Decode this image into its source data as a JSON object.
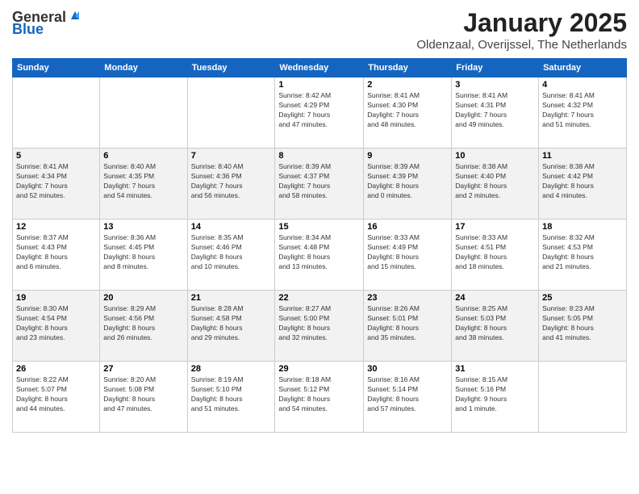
{
  "logo": {
    "general": "General",
    "blue": "Blue"
  },
  "header": {
    "title": "January 2025",
    "location": "Oldenzaal, Overijssel, The Netherlands"
  },
  "weekdays": [
    "Sunday",
    "Monday",
    "Tuesday",
    "Wednesday",
    "Thursday",
    "Friday",
    "Saturday"
  ],
  "weeks": [
    [
      {
        "day": "",
        "info": ""
      },
      {
        "day": "",
        "info": ""
      },
      {
        "day": "",
        "info": ""
      },
      {
        "day": "1",
        "info": "Sunrise: 8:42 AM\nSunset: 4:29 PM\nDaylight: 7 hours and 47 minutes."
      },
      {
        "day": "2",
        "info": "Sunrise: 8:41 AM\nSunset: 4:30 PM\nDaylight: 7 hours and 48 minutes."
      },
      {
        "day": "3",
        "info": "Sunrise: 8:41 AM\nSunset: 4:31 PM\nDaylight: 7 hours and 49 minutes."
      },
      {
        "day": "4",
        "info": "Sunrise: 8:41 AM\nSunset: 4:32 PM\nDaylight: 7 hours and 51 minutes."
      }
    ],
    [
      {
        "day": "5",
        "info": "Sunrise: 8:41 AM\nSunset: 4:34 PM\nDaylight: 7 hours and 52 minutes."
      },
      {
        "day": "6",
        "info": "Sunrise: 8:40 AM\nSunset: 4:35 PM\nDaylight: 7 hours and 54 minutes."
      },
      {
        "day": "7",
        "info": "Sunrise: 8:40 AM\nSunset: 4:36 PM\nDaylight: 7 hours and 56 minutes."
      },
      {
        "day": "8",
        "info": "Sunrise: 8:39 AM\nSunset: 4:37 PM\nDaylight: 7 hours and 58 minutes."
      },
      {
        "day": "9",
        "info": "Sunrise: 8:39 AM\nSunset: 4:39 PM\nDaylight: 8 hours and 0 minutes."
      },
      {
        "day": "10",
        "info": "Sunrise: 8:38 AM\nSunset: 4:40 PM\nDaylight: 8 hours and 2 minutes."
      },
      {
        "day": "11",
        "info": "Sunrise: 8:38 AM\nSunset: 4:42 PM\nDaylight: 8 hours and 4 minutes."
      }
    ],
    [
      {
        "day": "12",
        "info": "Sunrise: 8:37 AM\nSunset: 4:43 PM\nDaylight: 8 hours and 6 minutes."
      },
      {
        "day": "13",
        "info": "Sunrise: 8:36 AM\nSunset: 4:45 PM\nDaylight: 8 hours and 8 minutes."
      },
      {
        "day": "14",
        "info": "Sunrise: 8:35 AM\nSunset: 4:46 PM\nDaylight: 8 hours and 10 minutes."
      },
      {
        "day": "15",
        "info": "Sunrise: 8:34 AM\nSunset: 4:48 PM\nDaylight: 8 hours and 13 minutes."
      },
      {
        "day": "16",
        "info": "Sunrise: 8:33 AM\nSunset: 4:49 PM\nDaylight: 8 hours and 15 minutes."
      },
      {
        "day": "17",
        "info": "Sunrise: 8:33 AM\nSunset: 4:51 PM\nDaylight: 8 hours and 18 minutes."
      },
      {
        "day": "18",
        "info": "Sunrise: 8:32 AM\nSunset: 4:53 PM\nDaylight: 8 hours and 21 minutes."
      }
    ],
    [
      {
        "day": "19",
        "info": "Sunrise: 8:30 AM\nSunset: 4:54 PM\nDaylight: 8 hours and 23 minutes."
      },
      {
        "day": "20",
        "info": "Sunrise: 8:29 AM\nSunset: 4:56 PM\nDaylight: 8 hours and 26 minutes."
      },
      {
        "day": "21",
        "info": "Sunrise: 8:28 AM\nSunset: 4:58 PM\nDaylight: 8 hours and 29 minutes."
      },
      {
        "day": "22",
        "info": "Sunrise: 8:27 AM\nSunset: 5:00 PM\nDaylight: 8 hours and 32 minutes."
      },
      {
        "day": "23",
        "info": "Sunrise: 8:26 AM\nSunset: 5:01 PM\nDaylight: 8 hours and 35 minutes."
      },
      {
        "day": "24",
        "info": "Sunrise: 8:25 AM\nSunset: 5:03 PM\nDaylight: 8 hours and 38 minutes."
      },
      {
        "day": "25",
        "info": "Sunrise: 8:23 AM\nSunset: 5:05 PM\nDaylight: 8 hours and 41 minutes."
      }
    ],
    [
      {
        "day": "26",
        "info": "Sunrise: 8:22 AM\nSunset: 5:07 PM\nDaylight: 8 hours and 44 minutes."
      },
      {
        "day": "27",
        "info": "Sunrise: 8:20 AM\nSunset: 5:08 PM\nDaylight: 8 hours and 47 minutes."
      },
      {
        "day": "28",
        "info": "Sunrise: 8:19 AM\nSunset: 5:10 PM\nDaylight: 8 hours and 51 minutes."
      },
      {
        "day": "29",
        "info": "Sunrise: 8:18 AM\nSunset: 5:12 PM\nDaylight: 8 hours and 54 minutes."
      },
      {
        "day": "30",
        "info": "Sunrise: 8:16 AM\nSunset: 5:14 PM\nDaylight: 8 hours and 57 minutes."
      },
      {
        "day": "31",
        "info": "Sunrise: 8:15 AM\nSunset: 5:16 PM\nDaylight: 9 hours and 1 minute."
      },
      {
        "day": "",
        "info": ""
      }
    ]
  ]
}
